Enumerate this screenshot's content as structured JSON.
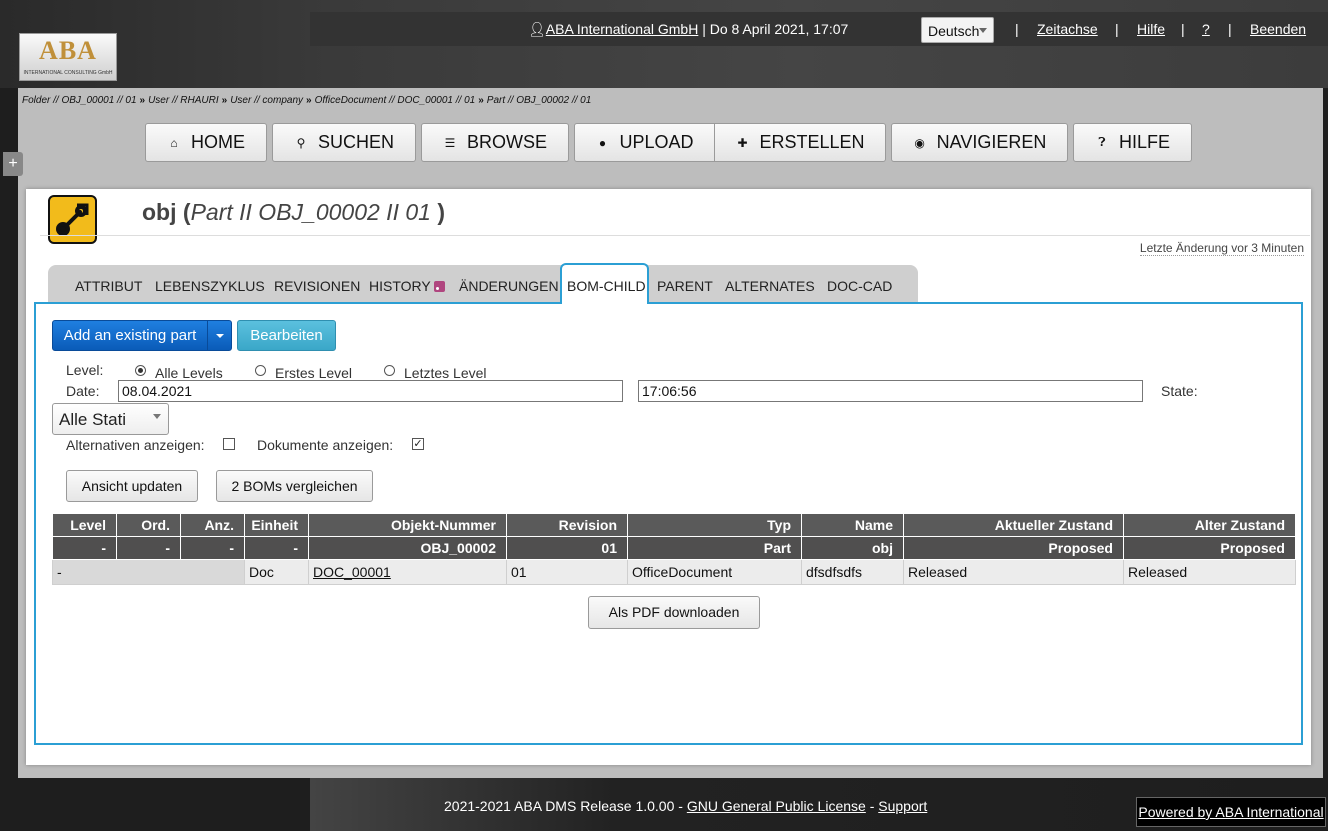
{
  "header": {
    "logo_text": "ABA",
    "logo_subtext": "INTERNATIONAL CONSULTING GmbH",
    "user_company": "ABA International GmbH",
    "separator": "|",
    "datetime": "Do 8 April 2021, 17:07",
    "language": "Deutsch",
    "links": [
      "Zeitachse",
      "Hilfe",
      "?",
      "Beenden"
    ]
  },
  "breadcrumb": [
    "Folder // OBJ_00001 // 01",
    "User // RHAURI",
    "User // company",
    "OfficeDocument // DOC_00001 // 01",
    "Part // OBJ_00002 // 01"
  ],
  "breadcrumb_sep": "»",
  "nav": {
    "side_toggle": "+",
    "buttons": [
      "HOME",
      "SUCHEN",
      "BROWSE",
      "UPLOAD",
      "ERSTELLEN",
      "NAVIGIEREN",
      "HILFE"
    ]
  },
  "object": {
    "name": "obj",
    "open_paren": "(",
    "subtitle": "Part II OBJ_00002 II  01",
    "close_paren": ")",
    "last_change": "Letzte Änderung vor 3 Minuten"
  },
  "tabs": [
    "ATTRIBUT",
    "LEBENSZYKLUS",
    "REVISIONEN",
    "HISTORY",
    "ÄNDERUNGEN",
    "BOM-CHILD",
    "PARENT",
    "ALTERNATES",
    "DOC-CAD"
  ],
  "active_tab": "BOM-CHILD",
  "actions": {
    "add_part": "Add an existing part",
    "edit": "Bearbeiten"
  },
  "filters": {
    "level_label": "Level:",
    "level_options": [
      "Alle Levels",
      "Erstes Level",
      "Letztes Level"
    ],
    "level_selected": "Alle Levels",
    "date_label": "Date:",
    "date_value": "08.04.2021",
    "time_value": "17:06:56",
    "state_label": "State:",
    "state_value": "Alle Stati",
    "alternatives_label": "Alternativen anzeigen:",
    "alternatives_checked": false,
    "documents_label": "Dokumente anzeigen:",
    "documents_checked": true,
    "update_button": "Ansicht updaten",
    "compare_button": "2 BOMs vergleichen"
  },
  "table": {
    "headers": [
      "Level",
      "Ord.",
      "Anz.",
      "Einheit",
      "Objekt-Nummer",
      "Revision",
      "Typ",
      "Name",
      "Aktueller Zustand",
      "Alter Zustand"
    ],
    "summary": [
      "-",
      "-",
      "-",
      "-",
      "OBJ_00002",
      "01",
      "Part",
      "obj",
      "Proposed",
      "Proposed"
    ],
    "rows": [
      {
        "level": "-",
        "unit": "Doc",
        "number": "DOC_00001",
        "revision": "01",
        "type": "OfficeDocument",
        "name": "dfsdfsdfs",
        "current_state": "Released",
        "old_state": "Released"
      }
    ]
  },
  "pdf_button": "Als PDF downloaden",
  "footer": {
    "text": "2021-2021 ABA DMS Release 1.0.00 -",
    "license": "GNU General Public License",
    "dash": "-",
    "support": "Support",
    "powered": "Powered by ABA International"
  },
  "colors": {
    "accent_blue": "#2b9fd4",
    "primary_button": "#0a5bb8",
    "info_button": "#5bc0de",
    "table_header": "#5a5a5a",
    "object_icon": "#f2bb1b"
  }
}
